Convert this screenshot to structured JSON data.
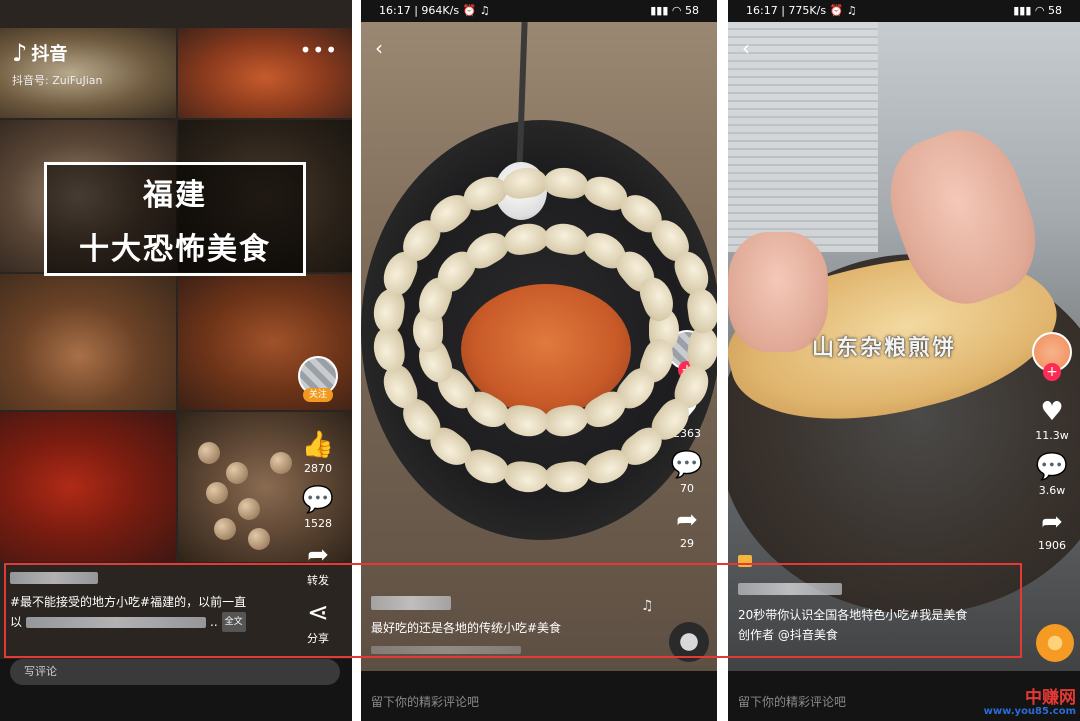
{
  "phone1": {
    "app_name": "抖音",
    "account_id": "抖音号: ZuiFuJian",
    "title_line1": "福建",
    "title_line2": "十大恐怖美食",
    "follow_badge": "关注",
    "likes": "2870",
    "comments": "1528",
    "share_label": "转发",
    "share2_label": "分享",
    "caption_line1": "#最不能接受的地方小吃#福建的，以前一直",
    "caption_line2_prefix": "以",
    "caption_line2_suffix": "..",
    "full_text_tag": "全文",
    "comment_placeholder": "写评论"
  },
  "phone2": {
    "time": "16:17",
    "speed": "964K/s",
    "battery": "58",
    "likes": "2363",
    "comments": "70",
    "shares": "29",
    "caption": "最好吃的还是各地的传统小吃#美食",
    "comment_placeholder": "留下你的精彩评论吧"
  },
  "phone3": {
    "time": "16:17",
    "speed": "775K/s",
    "battery": "58",
    "video_label": "山东杂粮煎饼",
    "likes": "11.3w",
    "comments": "3.6w",
    "shares": "1906",
    "caption_line1": "20秒带你认识全国各地特色小吃#我是美食",
    "caption_line2": "创作者 @抖音美食",
    "comment_placeholder": "留下你的精彩评论吧"
  },
  "watermark": {
    "brand": "中赚网",
    "url": "www.you85.com"
  },
  "icons": {
    "back": "back-arrow-icon",
    "like": "heart-icon",
    "thumb": "thumbs-up-icon",
    "comment": "comment-bubble-icon",
    "share": "share-arrow-icon",
    "more": "more-dots-icon"
  },
  "colors": {
    "highlight": "#e53935",
    "tiktok_red": "#fe2c55",
    "follow_orange": "#f29a1f",
    "watermark_red": "#e53935",
    "watermark_blue": "#2a6cd6"
  }
}
